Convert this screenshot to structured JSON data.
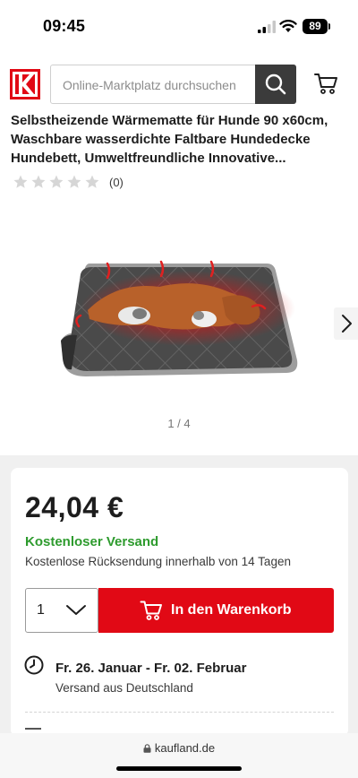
{
  "status_bar": {
    "time": "09:45",
    "battery": "89"
  },
  "header": {
    "search_placeholder": "Online-Marktplatz durchsuchen",
    "brand_color": "#e10915",
    "icons": [
      "kaufland-logo",
      "search-icon",
      "cart-icon"
    ]
  },
  "product": {
    "title": "Selbstheizende Wärmematte für Hunde 90 x60cm, Waschbare wasserdichte Faltbare Hundedecke Hundebett, Umweltfreundliche Innovative...",
    "rating": {
      "stars": 0,
      "max_stars": 5,
      "count_label": "(0)"
    },
    "image_pager": "1 / 4"
  },
  "buy_box": {
    "price": "24,04 €",
    "free_shipping": "Kostenloser Versand",
    "free_return": "Kostenlose Rücksendung innerhalb von 14 Tagen",
    "quantity": "1",
    "add_to_cart": "In den Warenkorb",
    "delivery_date": "Fr. 26. Januar - Fr. 02. Februar",
    "delivery_origin": "Versand aus Deutschland"
  },
  "browser": {
    "url": "kaufland.de"
  },
  "colors": {
    "accent": "#e10915",
    "shipping_green": "#2e9b2e",
    "dark": "#3b3b3b"
  }
}
